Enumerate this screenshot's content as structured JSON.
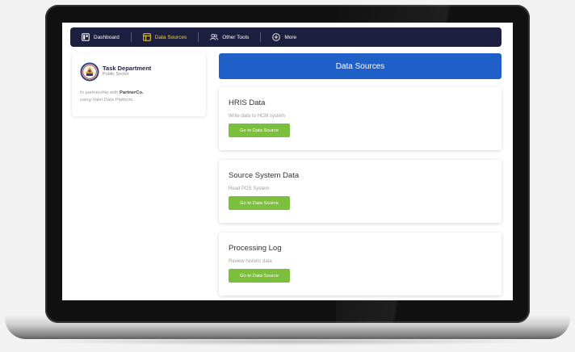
{
  "nav": {
    "items": [
      {
        "label": "Dashboard",
        "icon": "dashboard-icon"
      },
      {
        "label": "Data Sources",
        "icon": "table-icon",
        "active": true
      },
      {
        "label": "Other Tools",
        "icon": "users-icon"
      },
      {
        "label": "More",
        "icon": "plus-circle-icon"
      }
    ]
  },
  "org": {
    "name": "Task Department",
    "subtitle": "Public Sector",
    "note_prefix": "In partnership with ",
    "partner": "PartnerCo.",
    "note_line2": "using Valet Data Platform."
  },
  "header": {
    "title": "Data Sources"
  },
  "sources": [
    {
      "title": "HRIS Data",
      "description": "Write data to HCM system",
      "button": "Go to Data Source"
    },
    {
      "title": "Source System Data",
      "description": "Read POS System",
      "button": "Go to Data Source"
    },
    {
      "title": "Processing Log",
      "description": "Review historic data",
      "button": "Go to Data Source"
    }
  ],
  "colors": {
    "nav_bg": "#1c1f3f",
    "active_nav": "#f3d23b",
    "header_bg": "#1f5fc8",
    "button_bg": "#7bbf3c"
  }
}
